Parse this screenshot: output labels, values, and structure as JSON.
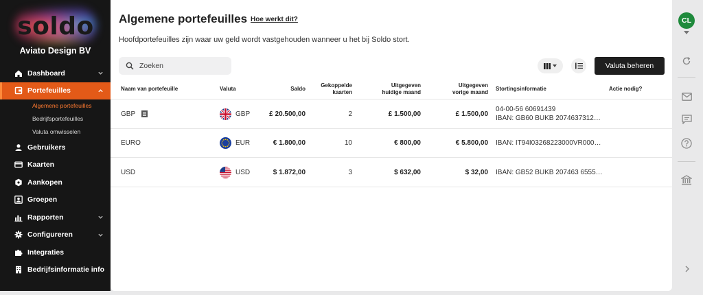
{
  "sidebar": {
    "logo_text": "soldo",
    "company": "Aviato Design BV",
    "items": [
      {
        "label": "Dashboard",
        "icon": "home-icon",
        "chevron": "down"
      },
      {
        "label": "Portefeuilles",
        "icon": "wallet-icon",
        "chevron": "up",
        "active": true
      },
      {
        "label": "Gebruikers",
        "icon": "user-icon"
      },
      {
        "label": "Kaarten",
        "icon": "card-icon"
      },
      {
        "label": "Aankopen",
        "icon": "purchase-icon"
      },
      {
        "label": "Groepen",
        "icon": "group-icon"
      },
      {
        "label": "Rapporten",
        "icon": "chart-icon",
        "chevron": "down"
      },
      {
        "label": "Configureren",
        "icon": "gear-icon",
        "chevron": "down"
      },
      {
        "label": "Integraties",
        "icon": "puzzle-icon"
      },
      {
        "label": "Bedrijfsinformatie info",
        "icon": "building-icon"
      }
    ],
    "sub_items": [
      {
        "label": "Algemene portefeuilles",
        "active": true
      },
      {
        "label": "Bedrijfsportefeuilles"
      },
      {
        "label": "Valuta omwisselen"
      }
    ]
  },
  "page": {
    "title": "Algemene portefeuilles",
    "help_link": "Hoe werkt dit?",
    "subtitle": "Hoofdportefeuilles zijn waar uw geld wordt vastgehouden wanneer u het bij Soldo stort."
  },
  "toolbar": {
    "search_placeholder": "Zoeken",
    "manage_button": "Valuta beheren"
  },
  "table": {
    "headers": {
      "name": "Naam van portefeuille",
      "currency": "Valuta",
      "balance": "Saldo",
      "cards_l1": "Gekoppelde",
      "cards_l2": "kaarten",
      "spent_cur_l1": "Uitgegeven",
      "spent_cur_l2": "huidige maand",
      "spent_prev_l1": "Uitgegeven",
      "spent_prev_l2": "vorige maand",
      "deposit": "Stortingsinformatie",
      "action": "Actie nodig?"
    },
    "rows": [
      {
        "name": "GBP",
        "currency": "GBP",
        "flag": "uk-flag-icon",
        "balance": "£ 20.500,00",
        "cards": "2",
        "spent_current": "£ 1.500,00",
        "spent_previous": "£ 1.500,00",
        "deposit_line1": "04-00-56 60691439",
        "deposit_line2": "IBAN: GB60 BUKB 2074637312…",
        "action": ""
      },
      {
        "name": "EURO",
        "currency": "EUR",
        "flag": "eu-flag-icon",
        "balance": "€ 1.800,00",
        "cards": "10",
        "spent_current": "€ 800,00",
        "spent_previous": "€ 5.800,00",
        "deposit_line1": "IBAN: IT94I03268223000VR000…",
        "deposit_line2": "",
        "action": ""
      },
      {
        "name": "USD",
        "currency": "USD",
        "flag": "us-flag-icon",
        "balance": "$ 1.872,00",
        "cards": "3",
        "spent_current": "$ 632,00",
        "spent_previous": "$ 32,00",
        "deposit_line1": "IBAN: GB52 BUKB 207463 6555…",
        "deposit_line2": "",
        "action": ""
      }
    ]
  },
  "rail": {
    "avatar_initials": "CL",
    "avatar_color": "#1f8a3c"
  },
  "colors": {
    "accent": "#e35a18",
    "sidebar_bg": "#161616",
    "button_dark": "#1f1f1f"
  }
}
